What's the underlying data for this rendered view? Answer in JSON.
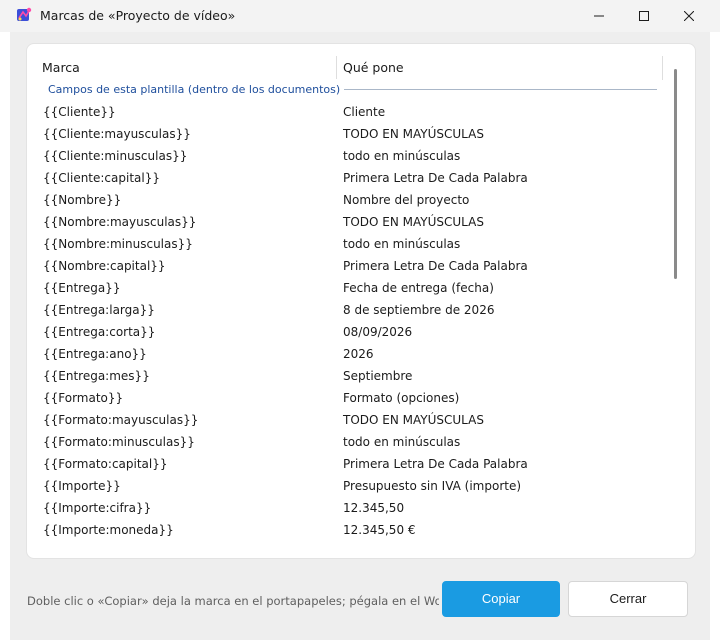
{
  "window": {
    "title": "Marcas de «Proyecto de vídeo»",
    "controls": {
      "minimize": "minimize",
      "maximize": "maximize",
      "close": "close"
    }
  },
  "table": {
    "columns": [
      "Marca",
      "Qué pone"
    ],
    "group_label": "Campos de esta plantilla (dentro de los documentos)",
    "rows": [
      {
        "key": "{{Cliente}}",
        "value": "Cliente"
      },
      {
        "key": "{{Cliente:mayusculas}}",
        "value": "TODO EN MAYÚSCULAS"
      },
      {
        "key": "{{Cliente:minusculas}}",
        "value": "todo en minúsculas"
      },
      {
        "key": "{{Cliente:capital}}",
        "value": "Primera Letra De Cada Palabra"
      },
      {
        "key": "{{Nombre}}",
        "value": "Nombre del proyecto"
      },
      {
        "key": "{{Nombre:mayusculas}}",
        "value": "TODO EN MAYÚSCULAS"
      },
      {
        "key": "{{Nombre:minusculas}}",
        "value": "todo en minúsculas"
      },
      {
        "key": "{{Nombre:capital}}",
        "value": "Primera Letra De Cada Palabra"
      },
      {
        "key": "{{Entrega}}",
        "value": "Fecha de entrega  (fecha)"
      },
      {
        "key": "{{Entrega:larga}}",
        "value": "8 de septiembre de 2026"
      },
      {
        "key": "{{Entrega:corta}}",
        "value": "08/09/2026"
      },
      {
        "key": "{{Entrega:ano}}",
        "value": "2026"
      },
      {
        "key": "{{Entrega:mes}}",
        "value": "Septiembre"
      },
      {
        "key": "{{Formato}}",
        "value": "Formato  (opciones)"
      },
      {
        "key": "{{Formato:mayusculas}}",
        "value": "TODO EN MAYÚSCULAS"
      },
      {
        "key": "{{Formato:minusculas}}",
        "value": "todo en minúsculas"
      },
      {
        "key": "{{Formato:capital}}",
        "value": "Primera Letra De Cada Palabra"
      },
      {
        "key": "{{Importe}}",
        "value": "Presupuesto sin IVA  (importe)"
      },
      {
        "key": "{{Importe:cifra}}",
        "value": "12.345,50"
      },
      {
        "key": "{{Importe:moneda}}",
        "value": "12.345,50 €"
      }
    ]
  },
  "footer": {
    "hint": "Doble clic o «Copiar» deja la marca en el portapapeles; pégala en el Word o en",
    "copy_label": "Copiar",
    "close_label": "Cerrar"
  },
  "colors": {
    "accent": "#1a9be2",
    "group_text": "#1e4e9c"
  }
}
